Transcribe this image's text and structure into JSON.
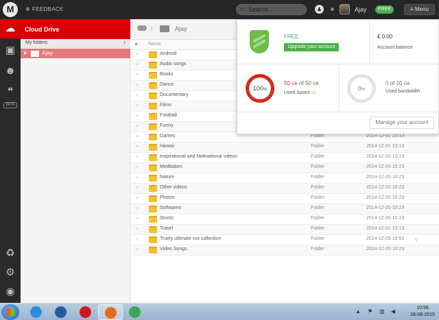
{
  "topbar": {
    "logo": "M",
    "feedback_label": "FEEDBACK",
    "search_placeholder": "Search",
    "username": "Ajay",
    "plan_badge": "FREE",
    "menu_label": "Menu"
  },
  "rail": {
    "items": [
      {
        "icon": "cloud-icon",
        "active": true
      },
      {
        "icon": "contacts-icon",
        "active": false
      },
      {
        "icon": "shared-users-icon",
        "active": false
      },
      {
        "icon": "chat-icon",
        "active": false
      }
    ],
    "beta_label": "BETA",
    "bottom_items": [
      "recycle-bin-icon",
      "settings-gear-icon",
      "camera-icon"
    ]
  },
  "tree": {
    "header": "Cloud Drive",
    "subheader": "My folders",
    "root_folder": "Ajay"
  },
  "breadcrumb": {
    "folder": "Ajay"
  },
  "list": {
    "name_header": "Name",
    "rows": [
      {
        "name": "Android",
        "type": "",
        "date": ""
      },
      {
        "name": "Audio songs",
        "type": "",
        "date": ""
      },
      {
        "name": "Books",
        "type": "",
        "date": ""
      },
      {
        "name": "Dance",
        "type": "",
        "date": ""
      },
      {
        "name": "Documentary",
        "type": "",
        "date": ""
      },
      {
        "name": "Films",
        "type": "",
        "date": ""
      },
      {
        "name": "Football",
        "type": "",
        "date": ""
      },
      {
        "name": "Funny",
        "type": "",
        "date": ""
      },
      {
        "name": "Games",
        "type": "Folder",
        "date": "2014-12-31 10:13"
      },
      {
        "name": "Hawaii",
        "type": "Folder",
        "date": "2014-12-31 10:13"
      },
      {
        "name": "Inspirational and Motivational videos",
        "type": "Folder",
        "date": "2014-12-20 10:23"
      },
      {
        "name": "Meditation",
        "type": "Folder",
        "date": "2014-12-20 10:23"
      },
      {
        "name": "Nature",
        "type": "Folder",
        "date": "2014-12-20 10:23"
      },
      {
        "name": "Other videos",
        "type": "Folder",
        "date": "2014-12-20 10:23"
      },
      {
        "name": "Photos",
        "type": "Folder",
        "date": "2014-12-20 10:23"
      },
      {
        "name": "Softwares",
        "type": "Folder",
        "date": "2014-12-20 10:23"
      },
      {
        "name": "Stunts",
        "type": "Folder",
        "date": "2014-12-20 10:23"
      },
      {
        "name": "Travel",
        "type": "Folder",
        "date": "2014-12-31 10:13"
      },
      {
        "name": "Truely ultimate xxx collection",
        "type": "Folder",
        "date": "2014-12-05 15:51",
        "link": true
      },
      {
        "name": "Video Songs",
        "type": "Folder",
        "date": "2014-12-20 10:23"
      }
    ]
  },
  "account": {
    "plan": "FREE",
    "upgrade_label": "Upgrade your account",
    "balance": "€ 0.00",
    "balance_label": "Account balance",
    "space_percent": "100",
    "space_used": "50",
    "space_total": "50",
    "space_label": "Used Space",
    "bandwidth_percent": "0",
    "bandwidth_used": "0",
    "bandwidth_total": "10",
    "bandwidth_label": "Used bandwidth",
    "manage_label": "Manage your account"
  },
  "taskbar": {
    "time": "10:56",
    "date": "28-08-2015",
    "apps": [
      {
        "icon": "internet-explorer-icon",
        "color": "#2b8fd8"
      },
      {
        "icon": "ccleaner-icon",
        "color": "#1f5e9e"
      },
      {
        "icon": "opera-icon",
        "color": "#d1171b"
      },
      {
        "icon": "firefox-icon",
        "color": "#e66a1a",
        "active": true
      },
      {
        "icon": "chrome-icon",
        "color": "#3aa757"
      }
    ]
  }
}
